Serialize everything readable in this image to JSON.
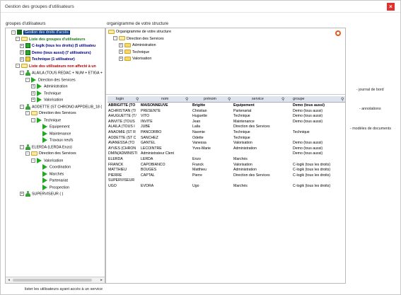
{
  "window": {
    "title": "Gestion des groupes d'utilisateurs"
  },
  "left": {
    "header": "groupes d'utilisateurs",
    "tree": [
      {
        "label": "Gestion des droits d'accès",
        "x": 8,
        "icon": "gbox dark",
        "pm": "-",
        "style": "sel"
      },
      {
        "label": "Liste des groupes d'utilisateurs",
        "x": 14,
        "icon": "folder open",
        "pm": "-",
        "style": "green"
      },
      {
        "label": "C-logik (tous les droits) (5 utilisateu",
        "x": 20,
        "icon": "gbox",
        "pm": "+",
        "style": "navy"
      },
      {
        "label": "Demo (tous aussi) (7 utilisateurs)",
        "x": 20,
        "icon": "gbox",
        "pm": "+",
        "style": "navy"
      },
      {
        "label": "Technique (1 utilisateur)",
        "x": 20,
        "icon": "gbox yellow",
        "pm": "+",
        "style": "navy"
      },
      {
        "label": "Liste des utilisateurs non affecté à un",
        "x": 14,
        "icon": "folder open",
        "pm": "-",
        "style": "red"
      },
      {
        "label": "ALAILA (TOUS REDAC + NUM + ETIGA +",
        "x": 20,
        "icon": "person",
        "pm": "-",
        "style": ""
      },
      {
        "label": "Direction des Services",
        "x": 28,
        "icon": "arrow",
        "pm": "-",
        "style": ""
      },
      {
        "label": "Administration",
        "x": 36,
        "icon": "arrow",
        "pm": "+",
        "style": ""
      },
      {
        "label": "Technique",
        "x": 36,
        "icon": "arrow",
        "pm": "+",
        "style": ""
      },
      {
        "label": "Valorisation",
        "x": 36,
        "icon": "arrow",
        "pm": "+",
        "style": ""
      },
      {
        "label": "AODETTE (ST CHRONO APPDELIB_18 (",
        "x": 20,
        "icon": "person",
        "pm": "-",
        "style": ""
      },
      {
        "label": "Direction des Services",
        "x": 28,
        "icon": "folder open",
        "pm": "-",
        "style": ""
      },
      {
        "label": "Technique",
        "x": 36,
        "icon": "arrow",
        "pm": "-",
        "style": ""
      },
      {
        "label": "Equipement",
        "x": 52,
        "icon": "arrow",
        "pm": "",
        "style": ""
      },
      {
        "label": "Maintenance",
        "x": 52,
        "icon": "arrow",
        "pm": "",
        "style": ""
      },
      {
        "label": "Travaux neufs",
        "x": 52,
        "icon": "arrow",
        "pm": "",
        "style": ""
      },
      {
        "label": "ELERDA (LERDA Enzo)",
        "x": 20,
        "icon": "person",
        "pm": "-",
        "style": ""
      },
      {
        "label": "Direction des Services",
        "x": 28,
        "icon": "folder open",
        "pm": "-",
        "style": ""
      },
      {
        "label": "Valorisation",
        "x": 36,
        "icon": "arrow",
        "pm": "-",
        "style": ""
      },
      {
        "label": "Coordination",
        "x": 52,
        "icon": "arrow",
        "pm": "",
        "style": ""
      },
      {
        "label": "Marchés",
        "x": 52,
        "icon": "arrow",
        "pm": "",
        "style": ""
      },
      {
        "label": "Partenariat",
        "x": 52,
        "icon": "arrow",
        "pm": "",
        "style": ""
      },
      {
        "label": "Prospection",
        "x": 52,
        "icon": "arrow",
        "pm": "",
        "style": ""
      },
      {
        "label": "SUPERVISEUR ( )",
        "x": 20,
        "icon": "person",
        "pm": "+",
        "style": ""
      }
    ]
  },
  "right": {
    "header": "organigramme de votre structure",
    "org": [
      {
        "label": "Organigramme de votre structure",
        "x": 3,
        "pm": "",
        "icon": "folder open"
      },
      {
        "label": "Direction des Services",
        "x": 10,
        "pm": "-",
        "icon": "folder open"
      },
      {
        "label": "Administration",
        "x": 18,
        "pm": "+",
        "icon": "folder"
      },
      {
        "label": "Technique",
        "x": 18,
        "pm": "+",
        "icon": "folder"
      },
      {
        "label": "Valorisation",
        "x": 18,
        "pm": "+",
        "icon": "folder"
      }
    ],
    "columns": [
      "login",
      "nom",
      "prénom",
      "service",
      "groupe"
    ],
    "rows": [
      [
        "ABRIGITTE (TO",
        "MAISONNEUVE",
        "Brigitte",
        "Equipement",
        "Demo (tous aussi)"
      ],
      [
        "ACHRISTIAN (T/",
        "PRESENTE",
        "Christian",
        "Partenariat",
        "Demo (tous aussi)"
      ],
      [
        "AHUGUETTE (T/",
        "VITO",
        "Huguette",
        "Technique",
        "Demo (tous aussi)"
      ],
      [
        "AINVITE (TOUS",
        "INVITE",
        "Jean",
        "Maintenance",
        "Demo (tous aussi)"
      ],
      [
        "ALAILA (TOUS I",
        "JUBE",
        "Laila",
        "Direction des Services",
        ""
      ],
      [
        "ANAOMIE (ST R",
        "PANCORBO",
        "Naomie",
        "Technique",
        "Technique"
      ],
      [
        "AODETTE (ST C",
        "SANCHEZ",
        "Odette",
        "Technique",
        ""
      ],
      [
        "AVANESSA (TO",
        "GANTEL",
        "Vanessa",
        "Valorisation",
        "Demo (tous aussi)"
      ],
      [
        "AYVES (CHRON",
        "LECOINTRE",
        "Yves-Marie",
        "Administration",
        "Demo (tous aussi)"
      ],
      [
        "DMIN(ADMINISTI",
        "Administrateur Clent",
        "",
        "",
        "Demo (tous aussi)"
      ],
      [
        "ELERDA",
        "LERDA",
        "Enzo",
        "Marchés",
        ""
      ],
      [
        "FRANCK",
        "CAPOBIANCO",
        "Franck",
        "Valorisation",
        "C-logik (tous les droits)"
      ],
      [
        "MATTHIEU",
        "BOUGES",
        "Matthieu",
        "Administration",
        "C-logik (tous les droits)"
      ],
      [
        "PIERRE",
        "CAPTAL",
        "Pierre",
        "Direction des Services",
        "C-logik (tous les droits)"
      ],
      [
        "SUPERVISEUR",
        "",
        "",
        "",
        ""
      ],
      [
        "UGO",
        "EVORA",
        "Ugo",
        "Marchés",
        "C-logik (tous les droits)"
      ]
    ]
  },
  "side_links": [
    "- journal de bord",
    "- annotations",
    "- modèles de documents"
  ],
  "footer": "lister les utilisateurs ayant accès à un service",
  "close_symbol": "×",
  "colors": {
    "selected": "#0a3c8c",
    "green_folder_text": "#1a7a1a",
    "red_text": "#b00000",
    "close": "#e03030"
  }
}
